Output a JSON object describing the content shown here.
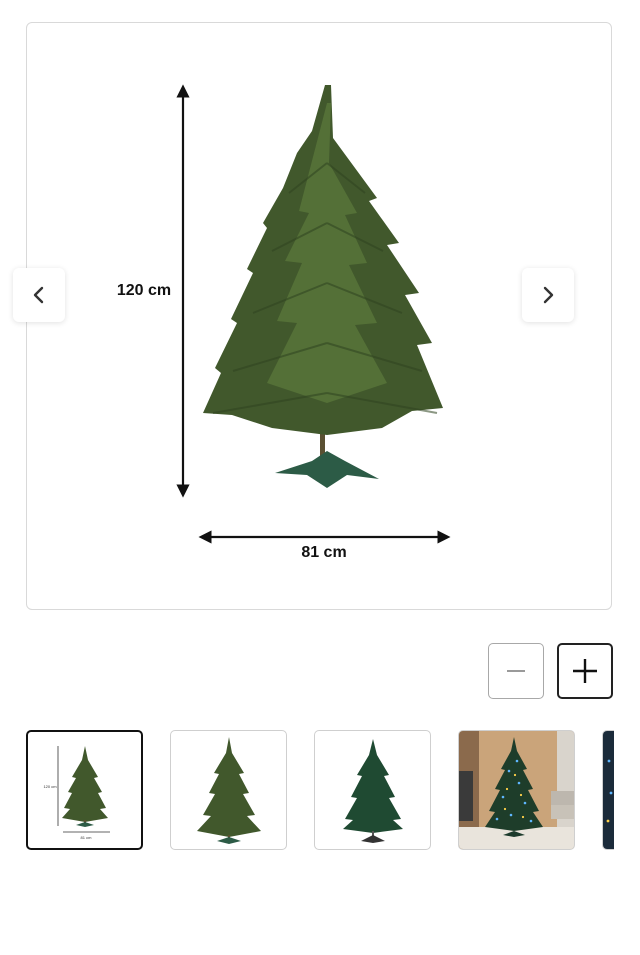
{
  "product_image": {
    "height_label": "120 cm",
    "width_label": "81 cm",
    "alt": "artificial christmas tree with dimensions"
  },
  "carousel": {
    "prev_icon": "chevron-left-icon",
    "next_icon": "chevron-right-icon"
  },
  "zoom": {
    "out_icon": "minus-icon",
    "in_icon": "plus-icon"
  },
  "thumbnails": {
    "selected_index": 0,
    "items": [
      {
        "kind": "tree-with-dimensions",
        "height_label": "120 cm",
        "width_label": "81 cm"
      },
      {
        "kind": "tree"
      },
      {
        "kind": "tree-dark-green"
      },
      {
        "kind": "tree-in-living-room-with-lights"
      },
      {
        "kind": "tree-partial"
      }
    ]
  },
  "colors": {
    "tree_green": "#3f5a2c",
    "stand_green": "#2c5b46",
    "border": "#d9d9d9",
    "selected_border": "#111111"
  }
}
